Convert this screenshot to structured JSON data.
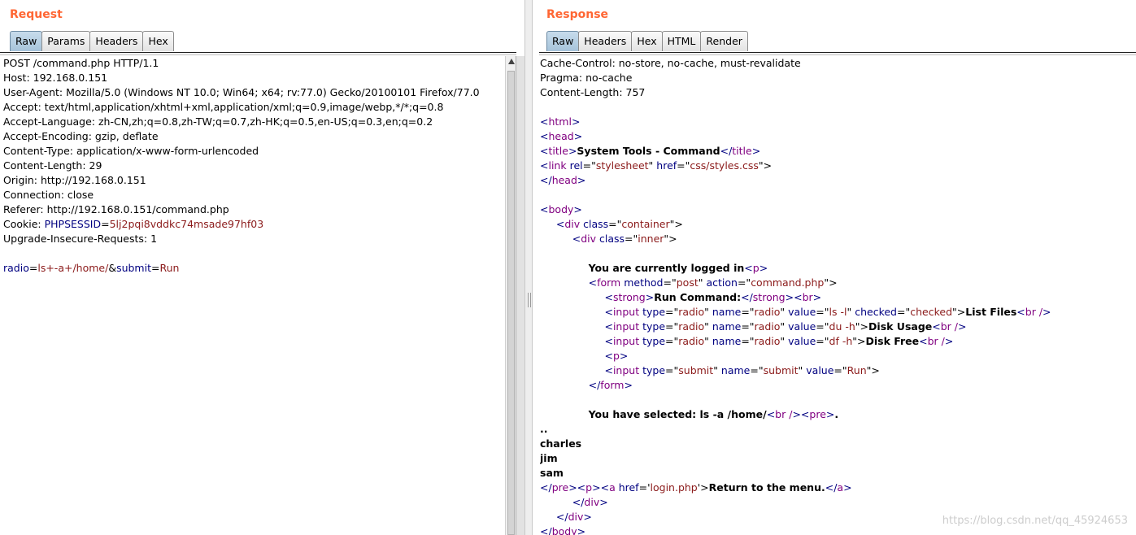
{
  "request": {
    "title": "Request",
    "tabs": [
      "Raw",
      "Params",
      "Headers",
      "Hex"
    ],
    "active_tab": "Raw",
    "lines": [
      [
        {
          "t": "POST /command.php HTTP/1.1"
        }
      ],
      [
        {
          "t": "Host: 192.168.0.151"
        }
      ],
      [
        {
          "t": "User-Agent: Mozilla/5.0 (Windows NT 10.0; Win64; x64; rv:77.0) Gecko/20100101 Firefox/77.0"
        }
      ],
      [
        {
          "t": "Accept: text/html,application/xhtml+xml,application/xml;q=0.9,image/webp,*/*;q=0.8"
        }
      ],
      [
        {
          "t": "Accept-Language: zh-CN,zh;q=0.8,zh-TW;q=0.7,zh-HK;q=0.5,en-US;q=0.3,en;q=0.2"
        }
      ],
      [
        {
          "t": "Accept-Encoding: gzip, deflate"
        }
      ],
      [
        {
          "t": "Content-Type: application/x-www-form-urlencoded"
        }
      ],
      [
        {
          "t": "Content-Length: 29"
        }
      ],
      [
        {
          "t": "Origin: http://192.168.0.151"
        }
      ],
      [
        {
          "t": "Connection: close"
        }
      ],
      [
        {
          "t": "Referer: http://192.168.0.151/command.php"
        }
      ],
      [
        {
          "t": "Cookie: "
        },
        {
          "t": "PHPSESSID",
          "c": "hk"
        },
        {
          "t": "="
        },
        {
          "t": "5lj2pqi8vddkc74msade97hf03",
          "c": "hv"
        }
      ],
      [
        {
          "t": "Upgrade-Insecure-Requests: 1"
        }
      ],
      [
        {
          "t": ""
        }
      ],
      [
        {
          "t": "radio",
          "c": "hk"
        },
        {
          "t": "="
        },
        {
          "t": "ls+-a+/home/",
          "c": "hv"
        },
        {
          "t": "&"
        },
        {
          "t": "submit",
          "c": "hk"
        },
        {
          "t": "="
        },
        {
          "t": "Run",
          "c": "hv"
        }
      ]
    ]
  },
  "response": {
    "title": "Response",
    "tabs": [
      "Raw",
      "Headers",
      "Hex",
      "HTML",
      "Render"
    ],
    "active_tab": "Raw",
    "lines": [
      [
        {
          "t": "Cache-Control: no-store, no-cache, must-revalidate"
        }
      ],
      [
        {
          "t": "Pragma: no-cache"
        }
      ],
      [
        {
          "t": "Content-Length: 757"
        }
      ],
      [
        {
          "t": ""
        }
      ],
      [
        {
          "t": "<",
          "c": "tg"
        },
        {
          "t": "html",
          "c": "at"
        },
        {
          "t": ">",
          "c": "tg"
        }
      ],
      [
        {
          "t": "<",
          "c": "tg"
        },
        {
          "t": "head",
          "c": "at"
        },
        {
          "t": ">",
          "c": "tg"
        }
      ],
      [
        {
          "t": "<",
          "c": "tg"
        },
        {
          "t": "title",
          "c": "at"
        },
        {
          "t": ">",
          "c": "tg"
        },
        {
          "t": "System Tools - Command",
          "c": "bd"
        },
        {
          "t": "</",
          "c": "tg"
        },
        {
          "t": "title",
          "c": "at"
        },
        {
          "t": ">",
          "c": "tg"
        }
      ],
      [
        {
          "t": "<",
          "c": "tg"
        },
        {
          "t": "link ",
          "c": "at"
        },
        {
          "t": "rel",
          "c": "tg"
        },
        {
          "t": "=\""
        },
        {
          "t": "stylesheet",
          "c": "av"
        },
        {
          "t": "\" "
        },
        {
          "t": "href",
          "c": "tg"
        },
        {
          "t": "=\""
        },
        {
          "t": "css/styles.css",
          "c": "av"
        },
        {
          "t": "\">"
        }
      ],
      [
        {
          "t": "</",
          "c": "tg"
        },
        {
          "t": "head",
          "c": "at"
        },
        {
          "t": ">",
          "c": "tg"
        }
      ],
      [
        {
          "t": ""
        }
      ],
      [
        {
          "t": "<",
          "c": "tg"
        },
        {
          "t": "body",
          "c": "at"
        },
        {
          "t": ">",
          "c": "tg"
        }
      ],
      [
        {
          "t": "\t<",
          "c": "tg"
        },
        {
          "t": "div ",
          "c": "at"
        },
        {
          "t": "class",
          "c": "tg"
        },
        {
          "t": "=\""
        },
        {
          "t": "container",
          "c": "av"
        },
        {
          "t": "\">"
        }
      ],
      [
        {
          "t": "\t\t<",
          "c": "tg"
        },
        {
          "t": "div ",
          "c": "at"
        },
        {
          "t": "class",
          "c": "tg"
        },
        {
          "t": "=\""
        },
        {
          "t": "inner",
          "c": "av"
        },
        {
          "t": "\">"
        }
      ],
      [
        {
          "t": ""
        }
      ],
      [
        {
          "t": "\t\t\t"
        },
        {
          "t": "You are currently logged in",
          "c": "bd"
        },
        {
          "t": "<",
          "c": "tg"
        },
        {
          "t": "p",
          "c": "at"
        },
        {
          "t": ">",
          "c": "tg"
        }
      ],
      [
        {
          "t": "\t\t\t<",
          "c": "tg"
        },
        {
          "t": "form ",
          "c": "at"
        },
        {
          "t": "method",
          "c": "tg"
        },
        {
          "t": "=\""
        },
        {
          "t": "post",
          "c": "av"
        },
        {
          "t": "\" "
        },
        {
          "t": "action",
          "c": "tg"
        },
        {
          "t": "=\""
        },
        {
          "t": "command.php",
          "c": "av"
        },
        {
          "t": "\">"
        }
      ],
      [
        {
          "t": "\t\t\t\t<",
          "c": "tg"
        },
        {
          "t": "strong",
          "c": "at"
        },
        {
          "t": ">",
          "c": "tg"
        },
        {
          "t": "Run Command:",
          "c": "bd"
        },
        {
          "t": "</",
          "c": "tg"
        },
        {
          "t": "strong",
          "c": "at"
        },
        {
          "t": ">",
          "c": "tg"
        },
        {
          "t": "<",
          "c": "tg"
        },
        {
          "t": "br",
          "c": "at"
        },
        {
          "t": ">",
          "c": "tg"
        }
      ],
      [
        {
          "t": "\t\t\t\t<",
          "c": "tg"
        },
        {
          "t": "input ",
          "c": "at"
        },
        {
          "t": "type",
          "c": "tg"
        },
        {
          "t": "=\""
        },
        {
          "t": "radio",
          "c": "av"
        },
        {
          "t": "\" "
        },
        {
          "t": "name",
          "c": "tg"
        },
        {
          "t": "=\""
        },
        {
          "t": "radio",
          "c": "av"
        },
        {
          "t": "\" "
        },
        {
          "t": "value",
          "c": "tg"
        },
        {
          "t": "=\""
        },
        {
          "t": "ls -l",
          "c": "av"
        },
        {
          "t": "\" "
        },
        {
          "t": "checked",
          "c": "tg"
        },
        {
          "t": "=\""
        },
        {
          "t": "checked",
          "c": "av"
        },
        {
          "t": "\">"
        },
        {
          "t": "List Files",
          "c": "bd"
        },
        {
          "t": "<",
          "c": "tg"
        },
        {
          "t": "br /",
          "c": "at"
        },
        {
          "t": ">",
          "c": "tg"
        }
      ],
      [
        {
          "t": "\t\t\t\t<",
          "c": "tg"
        },
        {
          "t": "input ",
          "c": "at"
        },
        {
          "t": "type",
          "c": "tg"
        },
        {
          "t": "=\""
        },
        {
          "t": "radio",
          "c": "av"
        },
        {
          "t": "\" "
        },
        {
          "t": "name",
          "c": "tg"
        },
        {
          "t": "=\""
        },
        {
          "t": "radio",
          "c": "av"
        },
        {
          "t": "\" "
        },
        {
          "t": "value",
          "c": "tg"
        },
        {
          "t": "=\""
        },
        {
          "t": "du -h",
          "c": "av"
        },
        {
          "t": "\">"
        },
        {
          "t": "Disk Usage",
          "c": "bd"
        },
        {
          "t": "<",
          "c": "tg"
        },
        {
          "t": "br /",
          "c": "at"
        },
        {
          "t": ">",
          "c": "tg"
        }
      ],
      [
        {
          "t": "\t\t\t\t<",
          "c": "tg"
        },
        {
          "t": "input ",
          "c": "at"
        },
        {
          "t": "type",
          "c": "tg"
        },
        {
          "t": "=\""
        },
        {
          "t": "radio",
          "c": "av"
        },
        {
          "t": "\" "
        },
        {
          "t": "name",
          "c": "tg"
        },
        {
          "t": "=\""
        },
        {
          "t": "radio",
          "c": "av"
        },
        {
          "t": "\" "
        },
        {
          "t": "value",
          "c": "tg"
        },
        {
          "t": "=\""
        },
        {
          "t": "df -h",
          "c": "av"
        },
        {
          "t": "\">"
        },
        {
          "t": "Disk Free",
          "c": "bd"
        },
        {
          "t": "<",
          "c": "tg"
        },
        {
          "t": "br /",
          "c": "at"
        },
        {
          "t": ">",
          "c": "tg"
        }
      ],
      [
        {
          "t": "\t\t\t\t<",
          "c": "tg"
        },
        {
          "t": "p",
          "c": "at"
        },
        {
          "t": ">",
          "c": "tg"
        }
      ],
      [
        {
          "t": "\t\t\t\t<",
          "c": "tg"
        },
        {
          "t": "input ",
          "c": "at"
        },
        {
          "t": "type",
          "c": "tg"
        },
        {
          "t": "=\""
        },
        {
          "t": "submit",
          "c": "av"
        },
        {
          "t": "\" "
        },
        {
          "t": "name",
          "c": "tg"
        },
        {
          "t": "=\""
        },
        {
          "t": "submit",
          "c": "av"
        },
        {
          "t": "\" "
        },
        {
          "t": "value",
          "c": "tg"
        },
        {
          "t": "=\""
        },
        {
          "t": "Run",
          "c": "av"
        },
        {
          "t": "\">"
        }
      ],
      [
        {
          "t": "\t\t\t</",
          "c": "tg"
        },
        {
          "t": "form",
          "c": "at"
        },
        {
          "t": ">",
          "c": "tg"
        }
      ],
      [
        {
          "t": ""
        }
      ],
      [
        {
          "t": "\t\t\t"
        },
        {
          "t": "You have selected: ls -a /home/",
          "c": "bd"
        },
        {
          "t": "<",
          "c": "tg"
        },
        {
          "t": "br /",
          "c": "at"
        },
        {
          "t": ">",
          "c": "tg"
        },
        {
          "t": "<",
          "c": "tg"
        },
        {
          "t": "pre",
          "c": "at"
        },
        {
          "t": ">",
          "c": "tg"
        },
        {
          "t": ".",
          "c": "bd"
        }
      ],
      [
        {
          "t": "..",
          "c": "bd"
        }
      ],
      [
        {
          "t": "charles",
          "c": "bd"
        }
      ],
      [
        {
          "t": "jim",
          "c": "bd"
        }
      ],
      [
        {
          "t": "sam",
          "c": "bd"
        }
      ],
      [
        {
          "t": "</",
          "c": "tg"
        },
        {
          "t": "pre",
          "c": "at"
        },
        {
          "t": ">",
          "c": "tg"
        },
        {
          "t": "<",
          "c": "tg"
        },
        {
          "t": "p",
          "c": "at"
        },
        {
          "t": ">",
          "c": "tg"
        },
        {
          "t": "<",
          "c": "tg"
        },
        {
          "t": "a ",
          "c": "at"
        },
        {
          "t": "href",
          "c": "tg"
        },
        {
          "t": "='"
        },
        {
          "t": "login.php",
          "c": "av"
        },
        {
          "t": "'>"
        },
        {
          "t": "Return to the menu.",
          "c": "bd"
        },
        {
          "t": "</",
          "c": "tg"
        },
        {
          "t": "a",
          "c": "at"
        },
        {
          "t": ">",
          "c": "tg"
        }
      ],
      [
        {
          "t": "\t\t</",
          "c": "tg"
        },
        {
          "t": "div",
          "c": "at"
        },
        {
          "t": ">",
          "c": "tg"
        }
      ],
      [
        {
          "t": "\t</",
          "c": "tg"
        },
        {
          "t": "div",
          "c": "at"
        },
        {
          "t": ">",
          "c": "tg"
        }
      ],
      [
        {
          "t": "</",
          "c": "tg"
        },
        {
          "t": "body",
          "c": "at"
        },
        {
          "t": ">",
          "c": "tg"
        }
      ]
    ]
  },
  "watermark": "https://blog.csdn.net/qq_45924653",
  "colors": {
    "title": "#ff6633",
    "header_key": "#000080",
    "header_value": "#8b1a1a",
    "tag": "#000080",
    "attr": "#800080"
  }
}
